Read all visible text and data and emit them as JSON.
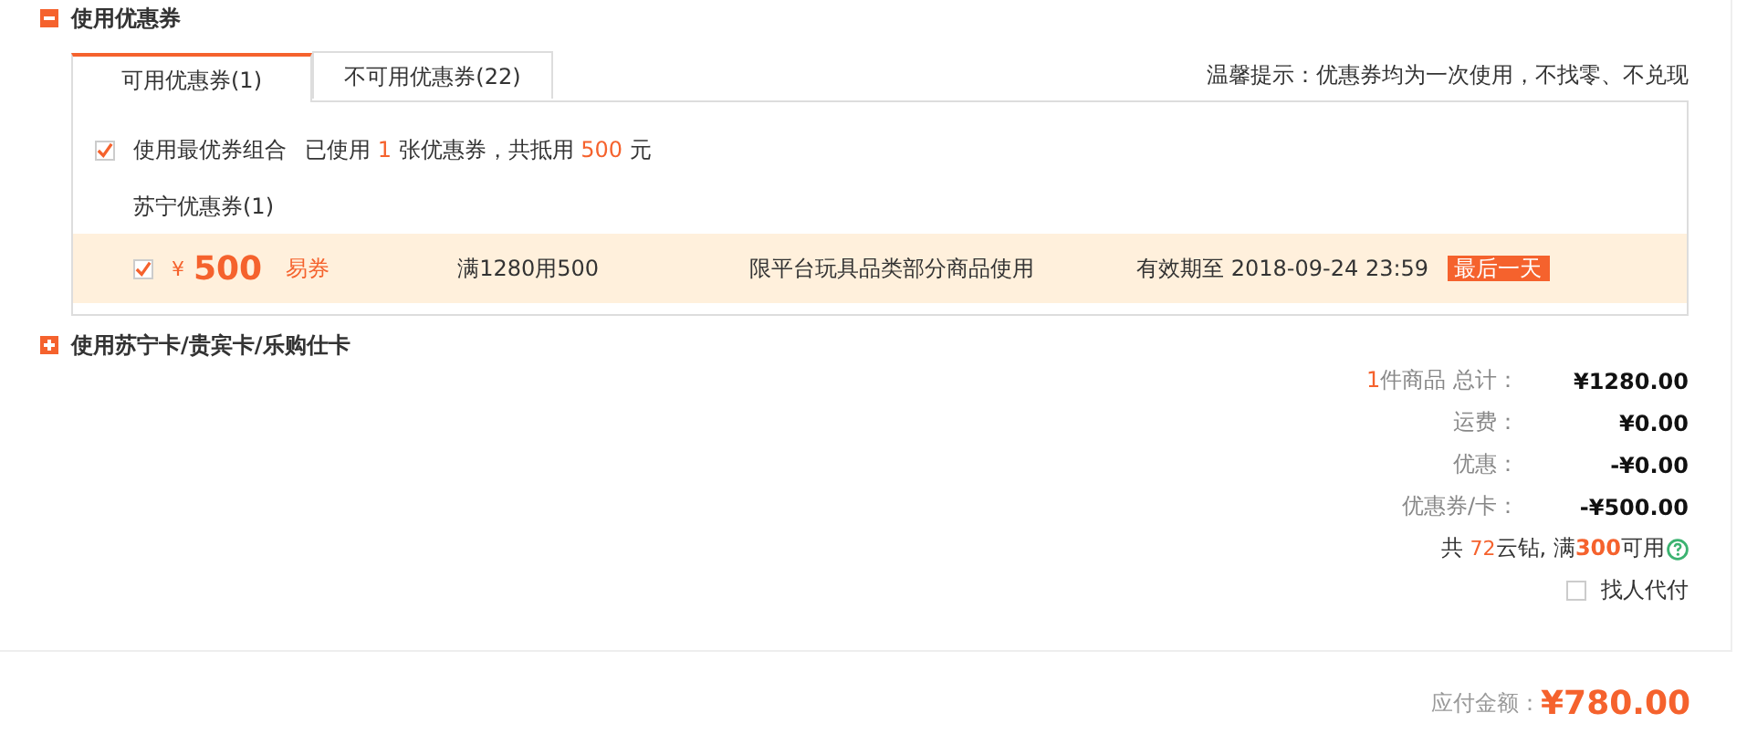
{
  "coupon_section": {
    "title": "使用优惠券",
    "expanded": true,
    "tabs": [
      {
        "label": "可用优惠券(1)",
        "selected": true
      },
      {
        "label": "不可用优惠券(22)",
        "selected": false
      }
    ],
    "tip": "温馨提示：优惠券均为一次使用，不找零、不兑现",
    "best_combo": {
      "label": "使用最优券组合",
      "checked": true,
      "used_prefix": "已使用",
      "used_count": "1",
      "used_middle": "张优惠券，共抵用",
      "used_amount": "500",
      "used_suffix": "元"
    },
    "group_title": "苏宁优惠券(1)",
    "coupons": [
      {
        "checked": true,
        "currency": "¥",
        "amount": "500",
        "type": "易券",
        "condition": "满1280用500",
        "scope": "限平台玩具品类部分商品使用",
        "validity": "有效期至 2018-09-24 23:59",
        "badge": "最后一天"
      }
    ]
  },
  "card_section": {
    "title": "使用苏宁卡/贵宾卡/乐购仕卡",
    "expanded": false
  },
  "summary": {
    "count": "1",
    "count_label": "件商品  总计：",
    "rows": [
      {
        "label": "运费：",
        "value": "¥0.00"
      },
      {
        "label": "优惠：",
        "value": "-¥0.00"
      },
      {
        "label": "优惠券/卡：",
        "value": "-¥500.00"
      }
    ],
    "first_value": "¥1280.00",
    "yunzuan": {
      "prefix": "共 ",
      "count": "72",
      "middle": "云钻, 满",
      "threshold": "300",
      "suffix": "可用"
    },
    "pay_for_me": {
      "label": "找人代付",
      "checked": false
    }
  },
  "total": {
    "label": "应付金额：",
    "value": "¥780.00"
  }
}
